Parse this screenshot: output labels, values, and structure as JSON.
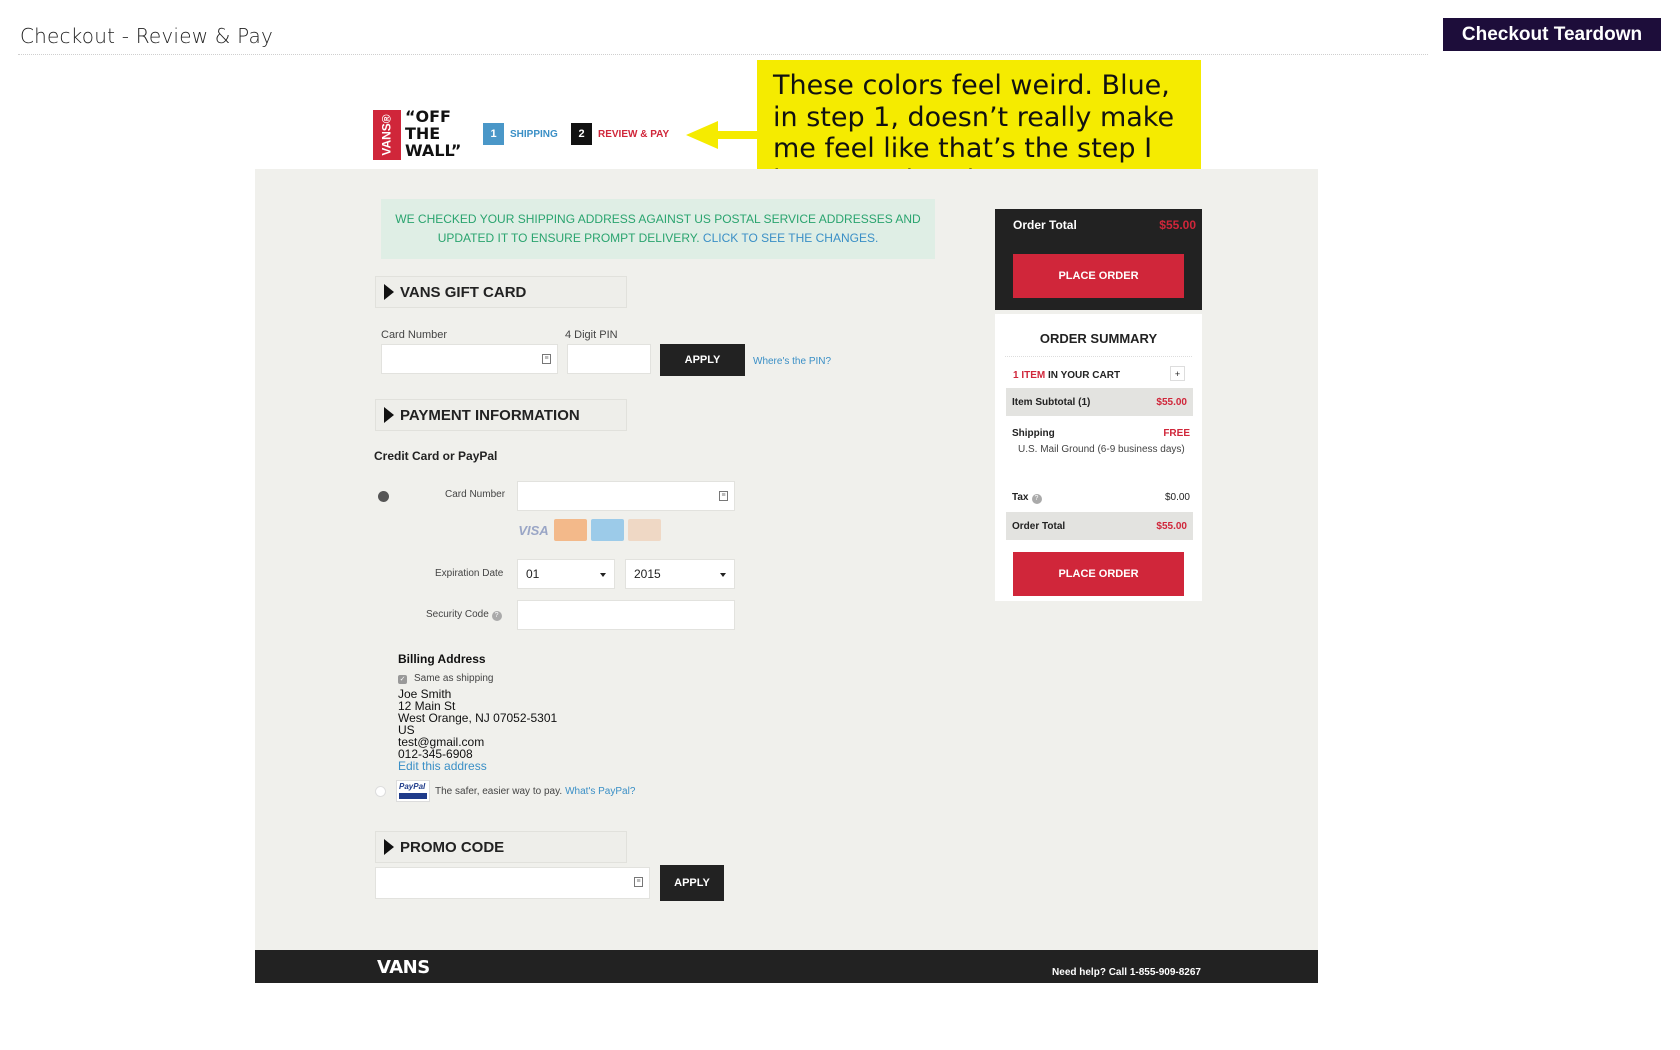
{
  "page": {
    "title": "Checkout - Review & Pay",
    "badge": "Checkout Teardown"
  },
  "header": {
    "logo_box_text": "VANS®",
    "logo_text": "“OFF THE WALL”",
    "steps": [
      {
        "number": "1",
        "label": "SHIPPING",
        "color": "#4a97c8"
      },
      {
        "number": "2",
        "label": "REVIEW & PAY",
        "color": "#d0263a"
      }
    ]
  },
  "annotation": {
    "text": "These colors feel weird. Blue, in step 1, doesn’t really make me feel like that’s the step I just completed.",
    "background": "#f5eb00"
  },
  "notice": {
    "text": "WE CHECKED YOUR SHIPPING ADDRESS AGAINST US POSTAL SERVICE ADDRESSES AND UPDATED IT TO ENSURE PROMPT DELIVERY.",
    "link": "CLICK TO SEE THE CHANGES."
  },
  "gift_card": {
    "header": "VANS GIFT CARD",
    "card_number_label": "Card Number",
    "pin_label": "4 Digit PIN",
    "apply_label": "APPLY",
    "pin_help": "Where's the PIN?"
  },
  "payment": {
    "header": "PAYMENT INFORMATION",
    "subtitle": "Credit Card or PayPal",
    "card_number_label": "Card Number",
    "card_icons": [
      "VISA",
      "MasterCard",
      "AMERICAN EXPRESS",
      "DISCOVER"
    ],
    "expiration_label": "Expiration Date",
    "exp_month": "01",
    "exp_year": "2015",
    "security_label": "Security Code",
    "billing": {
      "title": "Billing Address",
      "same_as_shipping": "Same as shipping",
      "lines": [
        "Joe  Smith",
        "12 Main St",
        "West Orange, NJ 07052-5301",
        "US",
        "test@gmail.com",
        "012-345-6908"
      ],
      "edit": "Edit this address"
    },
    "paypal": {
      "logo": "PayPal",
      "text": "The safer, easier way to pay.",
      "link": "What's PayPal?"
    }
  },
  "promo": {
    "header": "PROMO CODE",
    "apply_label": "APPLY"
  },
  "order_panel": {
    "total_label": "Order Total",
    "total_value": "$55.00",
    "place_order": "PLACE ORDER"
  },
  "summary": {
    "title": "ORDER SUMMARY",
    "cart_count": "1 ITEM",
    "cart_suffix": "IN YOUR CART",
    "plus": "+",
    "subtotal_label": "Item Subtotal (1)",
    "subtotal_value": "$55.00",
    "shipping_label": "Shipping",
    "shipping_value": "FREE",
    "shipping_desc": "U.S. Mail Ground (6-9 business days)",
    "tax_label": "Tax",
    "tax_value": "$0.00",
    "order_total_label": "Order Total",
    "order_total_value": "$55.00",
    "place_order": "PLACE ORDER"
  },
  "footer": {
    "logo": "VANS",
    "help": "Need help? Call 1-855-909-8267"
  }
}
